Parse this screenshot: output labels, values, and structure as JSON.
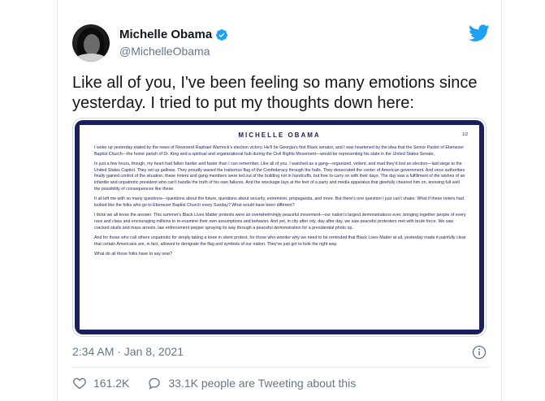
{
  "tweet": {
    "display_name": "Michelle Obama",
    "handle": "@MichelleObama",
    "text": "Like all of you, I've been feeling so many emotions since yesterday. I tried to put my thoughts down here:",
    "timestamp": "2:34 AM · Jan 8, 2021",
    "likes": "161.2K",
    "tweeting_label": "33.1K people are Tweeting about this"
  },
  "media": {
    "title": "MICHELLE OBAMA",
    "page": "1/2",
    "paragraphs": [
      "I woke up yesterday elated by the news of Reverend Raphael Warnock's election victory. He'll be Georgia's first Black senator, and I was heartened by the idea that the Senior Pastor of Ebenezer Baptist Church—the home parish of Dr. King and a spiritual and organizational hub during the Civil Rights Movement—would be representing his state in the United States Senate.",
      "In just a few hours, though, my heart had fallen harder and faster than I can remember. Like all of you, I watched as a gang—organized, violent, and mad they'd lost an election—laid siege to the United States Capitol. They set up gallows. They proudly waved the traitorous flag of the Confederacy through the halls. They desecrated the center of American government. And once authorities finally gained control of the situation, these rioters and gang members were led out of the building not in handcuffs, but free to carry on with their days. The day was a fulfillment of the wishes of an infantile and unpatriotic president who can't handle the truth of his own failures. And the wreckage lays at the feet of a party and media apparatus that gleefully cheered him on, knowing full well the possibility of consequences like these.",
      "It all left me with so many questions—questions about the future, questions about security, extremism, propaganda, and more. But there's one question I just can't shake: What if these rioters had looked like the folks who go to Ebenezer Baptist Church every Sunday? What would have been different?",
      "I think we all know the answer. This summer's Black Lives Matter protests were an overwhelmingly peaceful movement—our nation's largest demonstrations ever, bringing together people of every race and class and encouraging millions to re-examine their own assumptions and behavior. And yet, in city after city, day after day, we saw peaceful protesters met with brute force. We saw cracked skulls and mass arrests, law enforcement pepper spraying its way through a peaceful demonstration for a presidential photo op.",
      "And for those who call others unpatriotic for simply taking a knee in silent protest, for those who wonder why we need to be reminded that Black Lives Matter at all, yesterday made it painfully clear that certain Americans are, in fact, allowed to denigrate the flag and symbols of our nation. They've just got to look the right way.",
      "What do all those folks have to say now?"
    ]
  },
  "icons": {
    "verified": "verified-badge-icon",
    "brand": "twitter-bird-icon",
    "info": "info-icon",
    "like": "heart-icon",
    "tweeting": "speech-bubble-icon"
  },
  "colors": {
    "twitter_blue": "#1da1f2",
    "text_primary": "#14171a",
    "text_secondary": "#657786",
    "letter_navy": "#1b1f5c"
  }
}
